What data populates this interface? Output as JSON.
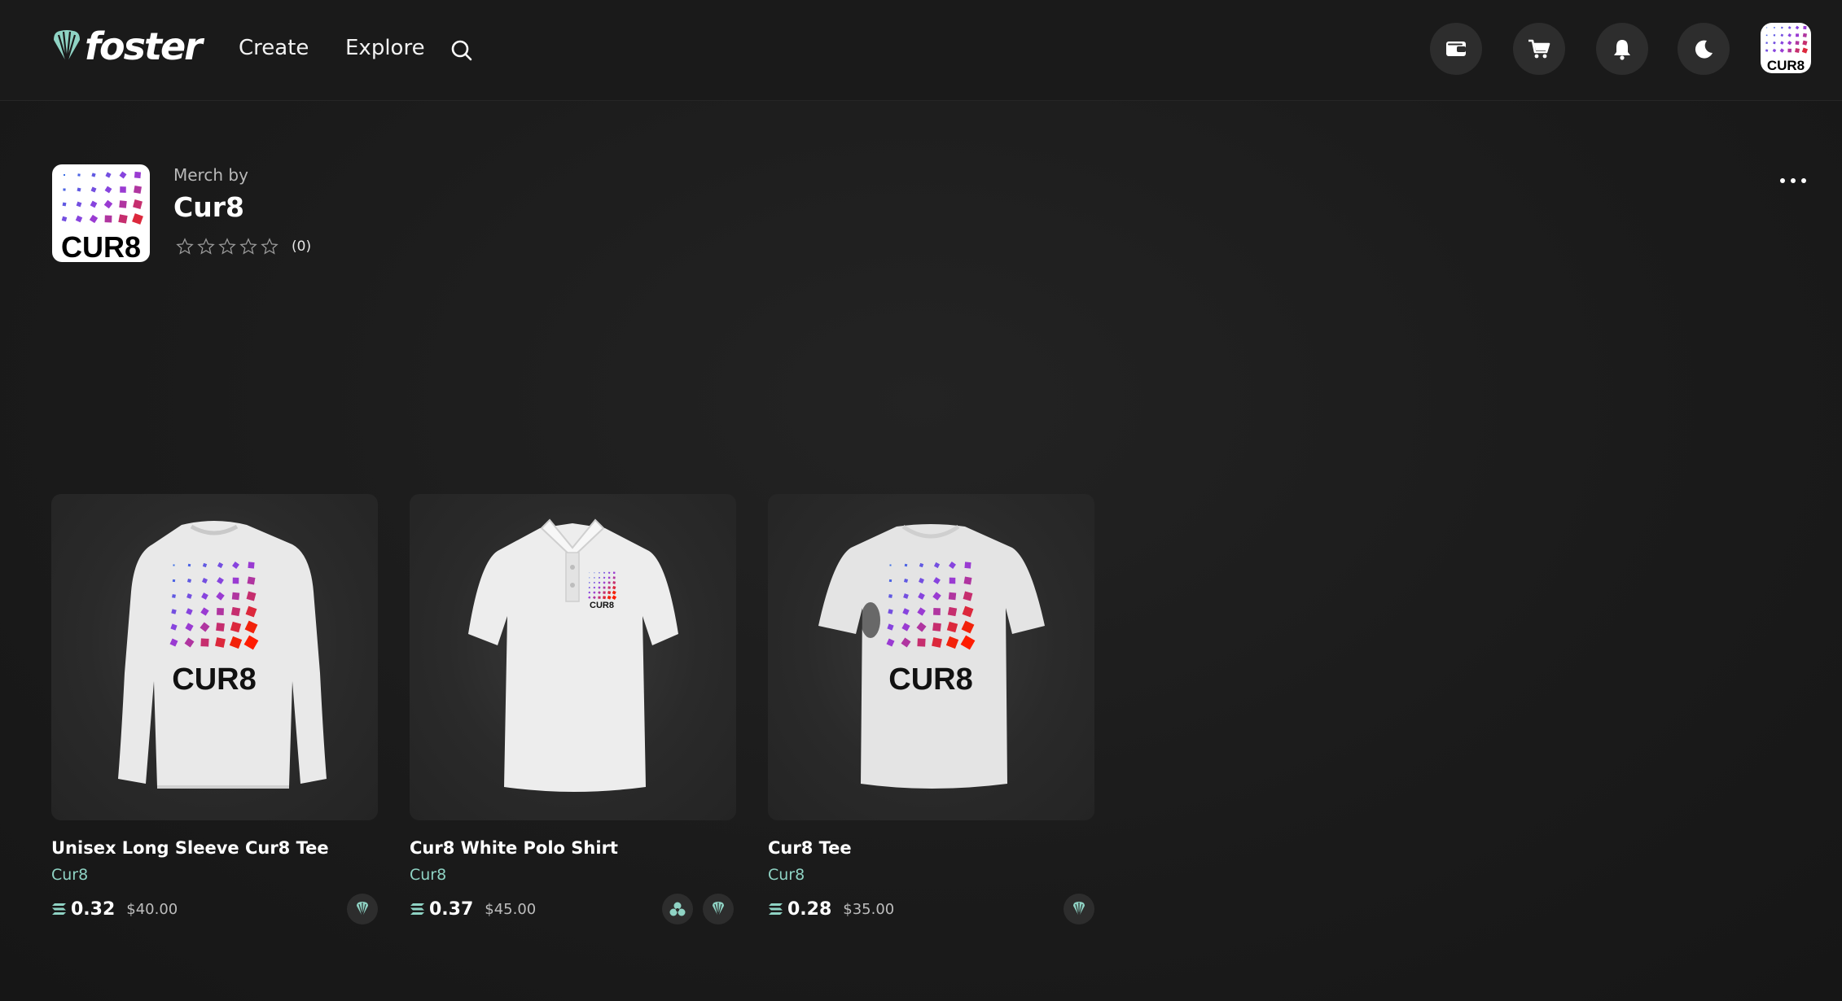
{
  "app": {
    "brand": "foster",
    "nav": {
      "create": "Create",
      "explore": "Explore"
    }
  },
  "header_icons": [
    "wallet-icon",
    "cart-icon",
    "bell-icon",
    "moon-icon",
    "profile-avatar"
  ],
  "store": {
    "merch_by_label": "Merch by",
    "name": "Cur8",
    "rating_stars": 0,
    "rating_max": 5,
    "rating_count": "(0)",
    "logo_text": "CUR8"
  },
  "colors": {
    "accent_teal": "#8fd3c4",
    "background": "#1b1b1b",
    "chip_bg": "#2d2d2d"
  },
  "products": [
    {
      "title": "Unisex Long Sleeve Cur8 Tee",
      "store": "Cur8",
      "price_sol": "0.32",
      "price_usd": "$40.00",
      "print_text": "CUR8",
      "badges": [
        "foster-badge-icon"
      ]
    },
    {
      "title": "Cur8 White Polo Shirt",
      "store": "Cur8",
      "price_sol": "0.37",
      "price_usd": "$45.00",
      "print_text": "CUR8",
      "badges": [
        "collab-badge-icon",
        "foster-badge-icon"
      ]
    },
    {
      "title": "Cur8 Tee",
      "store": "Cur8",
      "price_sol": "0.28",
      "price_usd": "$35.00",
      "print_text": "CUR8",
      "badges": [
        "foster-badge-icon"
      ]
    }
  ]
}
